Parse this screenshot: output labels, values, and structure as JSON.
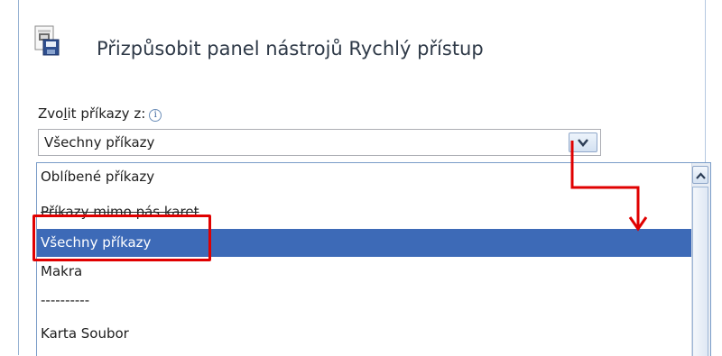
{
  "header": {
    "title": "Přizpůsobit panel nástrojů Rychlý přístup",
    "icon": "quick-access-toolbar-icon"
  },
  "commands": {
    "label_pre": "Zvo",
    "label_accel": "l",
    "label_post": "it příkazy z:",
    "info_symbol": "i",
    "selected_value": "Všechny příkazy"
  },
  "list": {
    "items": [
      {
        "label": "Oblíbené příkazy"
      },
      {
        "label": "Příkazy mimo pás karet"
      },
      {
        "label": "Všechny příkazy",
        "selected": true
      },
      {
        "label": "Makra"
      },
      {
        "label": "----------"
      },
      {
        "label": "Karta Soubor"
      }
    ]
  },
  "colors": {
    "selection": "#3d6ab7",
    "annotation": "#e00000"
  }
}
